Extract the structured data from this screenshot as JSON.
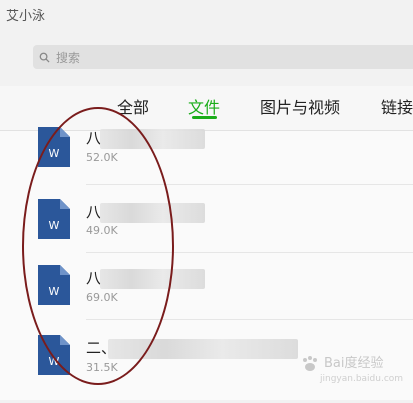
{
  "header": {
    "title": "艾小泳"
  },
  "search": {
    "placeholder": "搜索"
  },
  "tabs": [
    {
      "label": "全部"
    },
    {
      "label": "文件"
    },
    {
      "label": "图片与视频"
    },
    {
      "label": "链接"
    }
  ],
  "active_tab": "文件",
  "files": [
    {
      "name_visible": "八",
      "size": "52.0K",
      "icon": "word-doc-icon"
    },
    {
      "name_visible": "八",
      "size": "49.0K",
      "icon": "word-doc-icon"
    },
    {
      "name_visible": "八",
      "size": "69.0K",
      "icon": "word-doc-icon"
    },
    {
      "name_visible": "二、",
      "size": "31.5K",
      "icon": "word-doc-icon"
    }
  ],
  "icon_letter": "W",
  "watermark": {
    "main": "Bai度经验",
    "sub": "jingyan.baidu.com"
  },
  "colors": {
    "accent": "#1aad19",
    "word_icon": "#2b579a",
    "annotation": "#7a1c1c"
  }
}
